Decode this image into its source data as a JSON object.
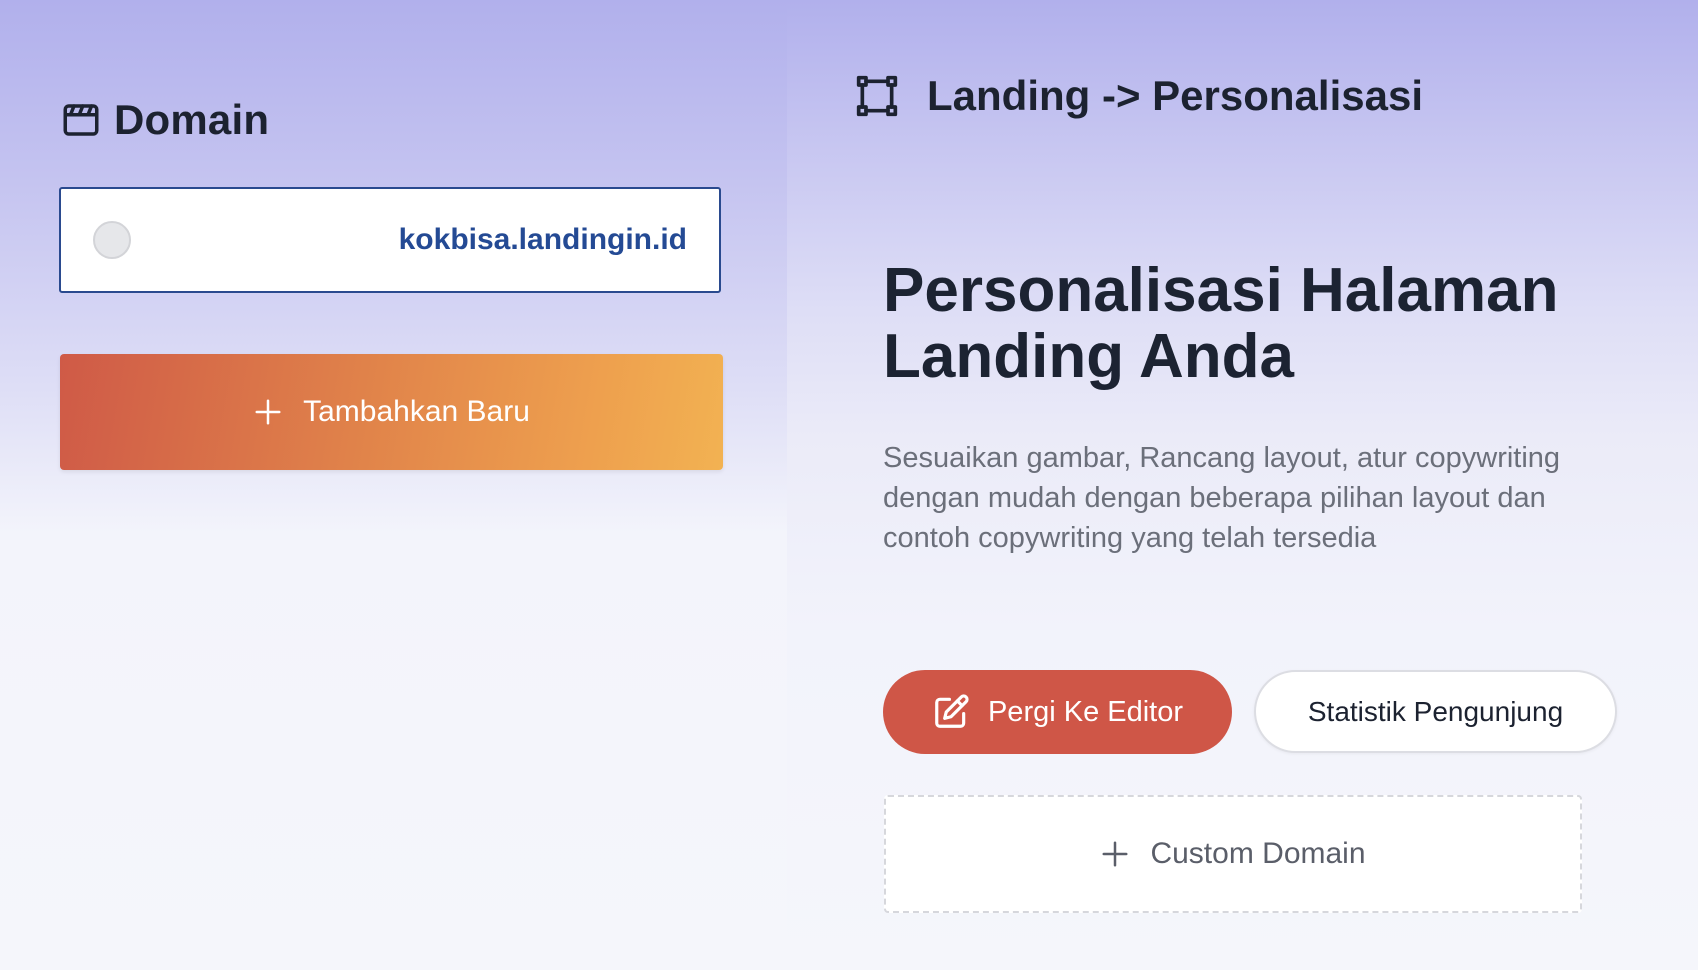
{
  "domain_section": {
    "title": "Domain",
    "icon": "clapperboard-icon",
    "selected_domain": "kokbisa.landingin.id",
    "add_button_label": "Tambahkan Baru"
  },
  "breadcrumb": {
    "icon": "frame-corners-icon",
    "label": "Landing -> Personalisasi"
  },
  "hero": {
    "title": "Personalisasi Halaman Landing Anda",
    "description": "Sesuaikan gambar, Rancang layout, atur copywriting dengan mudah dengan beberapa pilihan layout dan contoh copywriting yang telah tersedia"
  },
  "actions": {
    "editor_label": "Pergi Ke Editor",
    "editor_icon": "edit-icon",
    "stats_label": "Statistik Pengunjung",
    "custom_domain_label": "Custom Domain"
  },
  "colors": {
    "accent_red": "#cf5647",
    "gradient_start": "#cf5a47",
    "gradient_end": "#f2b252",
    "domain_text": "#244a94",
    "background_top": "#b1b0ec"
  }
}
